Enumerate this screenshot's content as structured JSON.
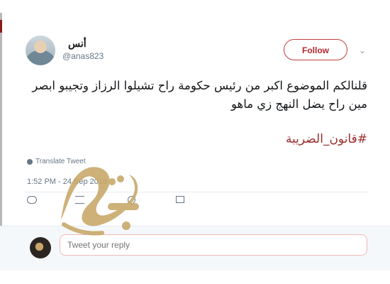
{
  "user": {
    "display_name": "أنس",
    "handle": "@anas823"
  },
  "header": {
    "follow_label": "Follow",
    "caret_icon": "chevron-down-icon"
  },
  "tweet": {
    "text": "قلنالكم الموضوع اكبر من رئيس حكومة راح تشيلوا الرزاز وتجيبو ابصر مين راح يضل النهج زي ماهو",
    "hashtag": "#قانون_الضريبة",
    "translate_label": "Translate Tweet",
    "timestamp": "1:52 PM - 24 Sep 2018"
  },
  "actions": {
    "icons": [
      "reply-icon",
      "retweet-icon",
      "like-icon",
      "message-icon"
    ]
  },
  "reply": {
    "placeholder": "Tweet your reply"
  },
  "watermark": {
    "label": "الوكيل"
  }
}
